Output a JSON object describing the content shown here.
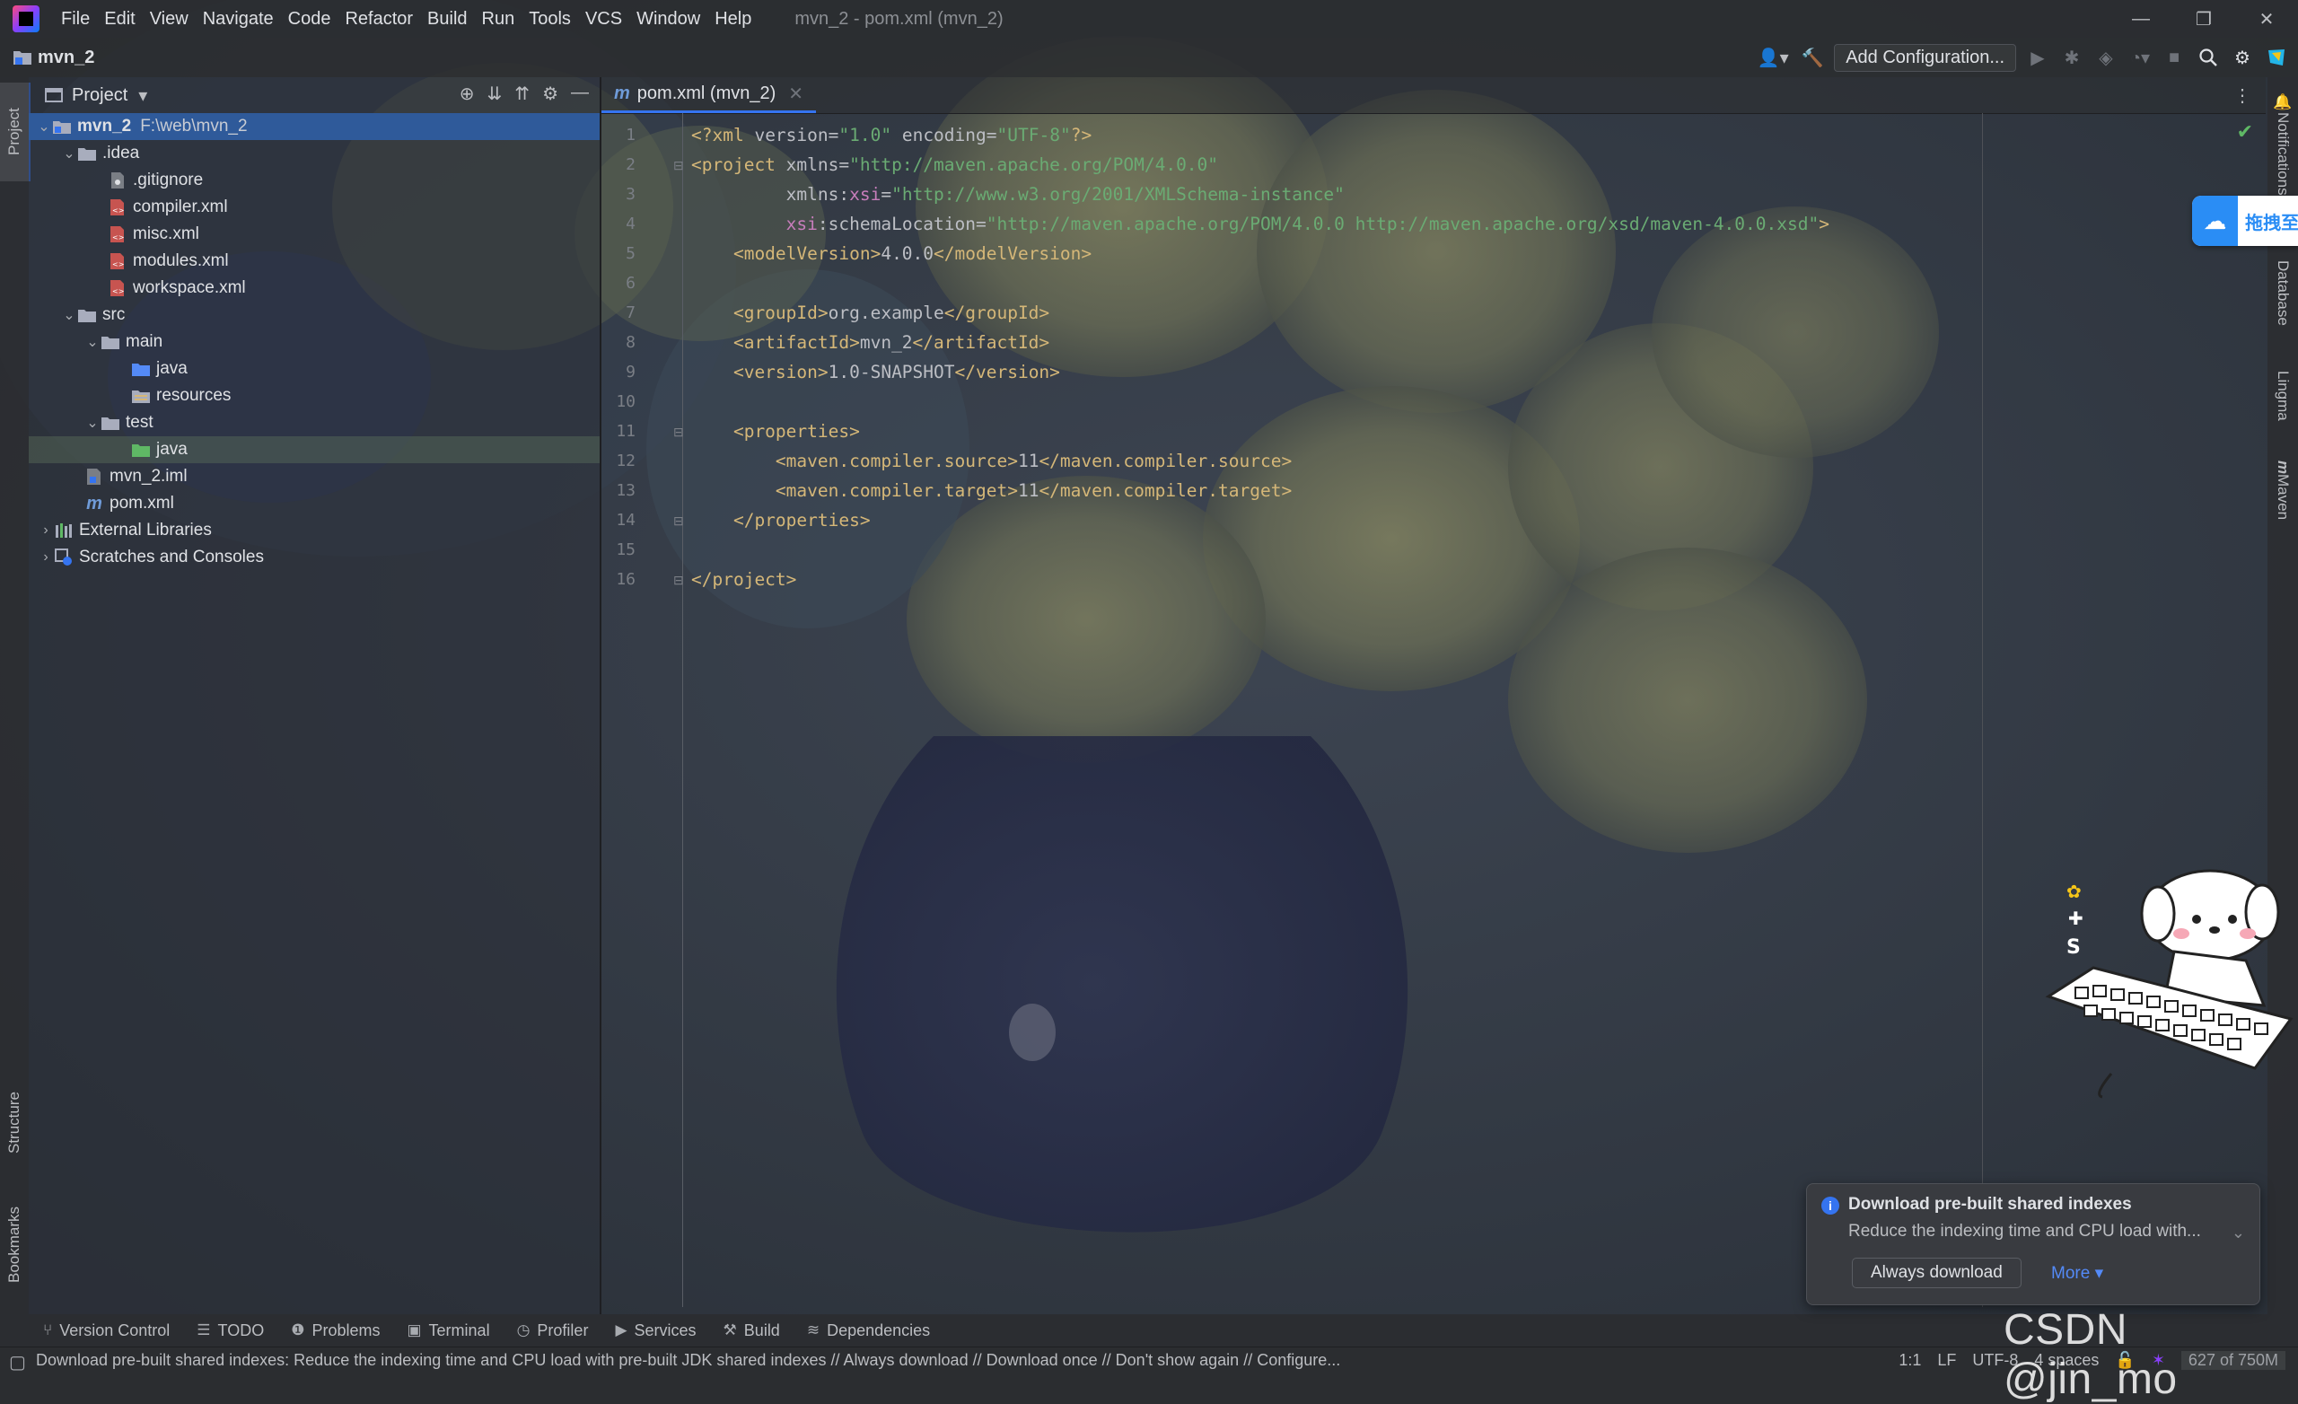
{
  "menu": [
    "File",
    "Edit",
    "View",
    "Navigate",
    "Code",
    "Refactor",
    "Build",
    "Run",
    "Tools",
    "VCS",
    "Window",
    "Help"
  ],
  "window_title": "mvn_2 - pom.xml (mvn_2)",
  "nav": {
    "project": "mvn_2",
    "add_config": "Add Configuration..."
  },
  "left_stripe": {
    "project": "Project",
    "structure": "Structure",
    "bookmarks": "Bookmarks"
  },
  "right_stripe": {
    "notifications": "Notifications",
    "database": "Database",
    "lingma": "Lingma",
    "maven": "Maven"
  },
  "project_panel": {
    "title": "Project",
    "tree": [
      {
        "label": "mvn_2",
        "hint": "F:\\web\\mvn_2"
      },
      {
        "label": ".idea"
      },
      {
        "label": ".gitignore"
      },
      {
        "label": "compiler.xml"
      },
      {
        "label": "misc.xml"
      },
      {
        "label": "modules.xml"
      },
      {
        "label": "workspace.xml"
      },
      {
        "label": "src"
      },
      {
        "label": "main"
      },
      {
        "label": "java"
      },
      {
        "label": "resources"
      },
      {
        "label": "test"
      },
      {
        "label": "java"
      },
      {
        "label": "mvn_2.iml"
      },
      {
        "label": "pom.xml"
      },
      {
        "label": "External Libraries"
      },
      {
        "label": "Scratches and Consoles"
      }
    ]
  },
  "editor": {
    "tab": "pom.xml (mvn_2)",
    "line_numbers": [
      "1",
      "2",
      "3",
      "4",
      "5",
      "6",
      "7",
      "8",
      "9",
      "10",
      "11",
      "12",
      "13",
      "14",
      "15",
      "16"
    ],
    "code": {
      "l1": [
        "<?xml ",
        "version",
        "=",
        "\"1.0\"",
        " encoding",
        "=",
        "\"UTF-8\"",
        "?>"
      ],
      "l2": [
        "<project",
        " xmlns",
        "=",
        "\"http://maven.apache.org/POM/4.0.0\""
      ],
      "l3": [
        "         xmlns:",
        "xsi",
        "=",
        "\"http://www.w3.org/2001/XMLSchema-instance\""
      ],
      "l4": [
        "         ",
        "xsi",
        ":schemaLocation=",
        "\"http://maven.apache.org/POM/4.0.0 http://maven.apache.org/xsd/maven-4.0.0.xsd\"",
        ">"
      ],
      "l5": [
        "    <modelVersion>",
        "4.0.0",
        "</modelVersion>"
      ],
      "l7": [
        "    <groupId>",
        "org.example",
        "</groupId>"
      ],
      "l8": [
        "    <artifactId>",
        "mvn_2",
        "</artifactId>"
      ],
      "l9": [
        "    <version>",
        "1.0-SNAPSHOT",
        "</version>"
      ],
      "l11": [
        "    <properties>"
      ],
      "l12": [
        "        <maven.compiler.source>",
        "11",
        "</maven.compiler.source>"
      ],
      "l13": [
        "        <maven.compiler.target>",
        "11",
        "</maven.compiler.target>"
      ],
      "l14": [
        "    </properties>"
      ],
      "l16": [
        "</project>"
      ]
    }
  },
  "drag_widget": {
    "label": "拖拽至"
  },
  "notification": {
    "title": "Download pre-built shared indexes",
    "body": "Reduce the indexing time and CPU load with...",
    "always": "Always download",
    "more": "More"
  },
  "tool_windows": [
    "Version Control",
    "TODO",
    "Problems",
    "Terminal",
    "Profiler",
    "Services",
    "Build",
    "Dependencies"
  ],
  "status": {
    "message": "Download pre-built shared indexes: Reduce the indexing time and CPU load with pre-built JDK shared indexes // Always download // Download once // Don't show again // Configure...",
    "position": "1:1",
    "line_sep": "LF",
    "encoding": "UTF-8",
    "indent": "4 spaces",
    "memory": "627 of 750M"
  },
  "watermark": "CSDN @jin_mo",
  "colors": {
    "accent": "#3574f0",
    "tag": "#d5b778",
    "string": "#6aab73",
    "namespace": "#c77dbb",
    "selection": "#2f5a9a"
  }
}
